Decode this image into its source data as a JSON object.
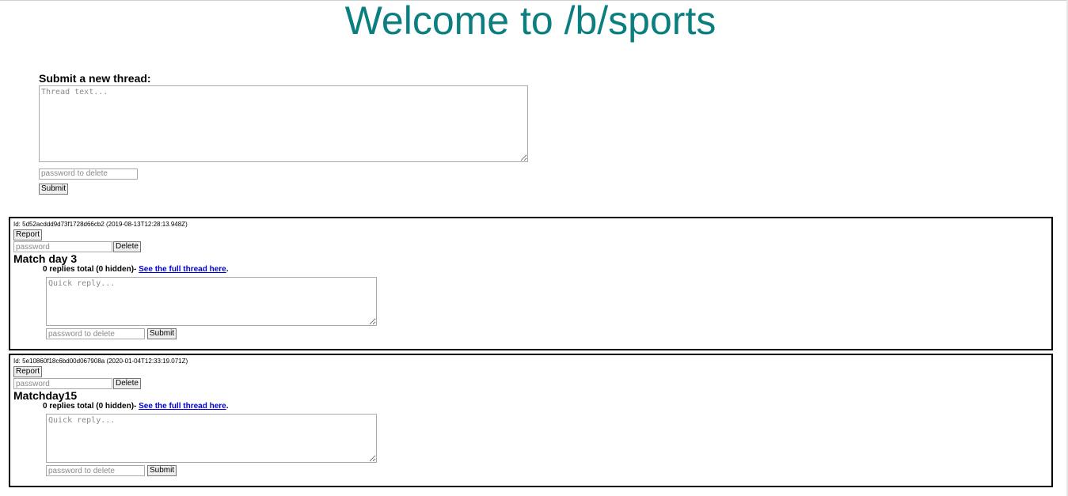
{
  "header": {
    "title": "Welcome to /b/sports"
  },
  "new_thread": {
    "label": "Submit a new thread:",
    "text_placeholder": "Thread text...",
    "password_placeholder": "password to delete",
    "submit_label": "Submit"
  },
  "threads": [
    {
      "meta": "Id: 5d52acddd9d73f1728d66cb2 (2019-08-13T12:28:13.948Z)",
      "report_label": "Report",
      "password_placeholder": "password",
      "delete_label": "Delete",
      "title": "Match day 3",
      "replies_text": "0 replies total (0 hidden)- ",
      "full_thread_link": "See the full thread here",
      "period": ".",
      "quick_reply_placeholder": "Quick reply...",
      "reply_password_placeholder": "password to delete",
      "submit_label": "Submit"
    },
    {
      "meta": "Id: 5e10860f18c6bd00d067908a (2020-01-04T12:33:19.071Z)",
      "report_label": "Report",
      "password_placeholder": "password",
      "delete_label": "Delete",
      "title": "Matchday15",
      "replies_text": "0 replies total (0 hidden)- ",
      "full_thread_link": "See the full thread here",
      "period": ".",
      "quick_reply_placeholder": "Quick reply...",
      "reply_password_placeholder": "password to delete",
      "submit_label": "Submit"
    }
  ]
}
